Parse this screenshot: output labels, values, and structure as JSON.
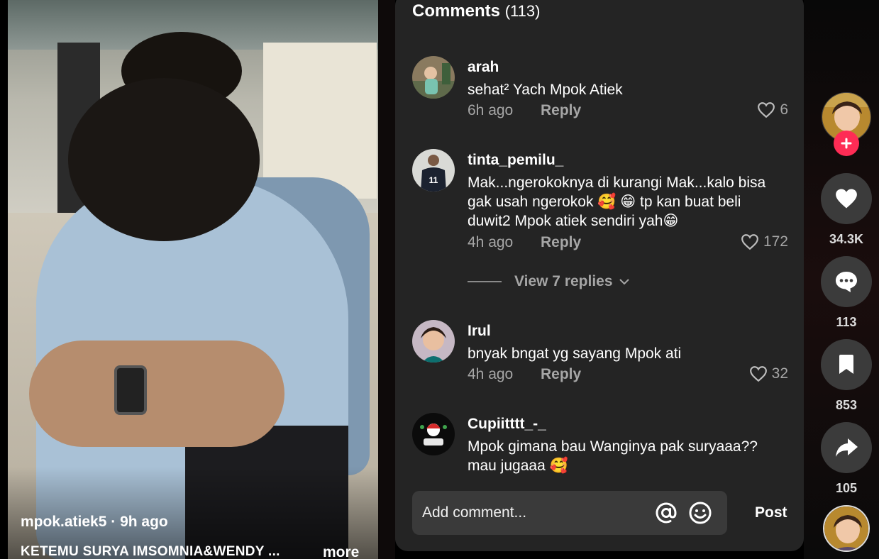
{
  "video": {
    "author": "mpok.atiek5",
    "separator": " · ",
    "posted": "9h ago",
    "caption": "KETEMU SURYA IMSOMNIA&WENDY ...",
    "more_label": "more"
  },
  "comments_header": {
    "title": "Comments",
    "count": "(113)"
  },
  "comments": [
    {
      "username": "arah",
      "text": "sehat² Yach Mpok Atiek",
      "time": "6h ago",
      "reply_label": "Reply",
      "likes": "6"
    },
    {
      "username": "tinta_pemilu_",
      "text": "Mak...ngerokoknya di kurangi Mak...kalo bisa gak usah ngerokok 🥰 😁  tp kan buat beli duwit2 Mpok atiek sendiri yah😁",
      "time": "4h ago",
      "reply_label": "Reply",
      "likes": "172"
    },
    {
      "username": "Irul",
      "text": "bnyak bngat yg sayang Mpok ati",
      "time": "4h ago",
      "reply_label": "Reply",
      "likes": "32"
    },
    {
      "username": "Cupiitttt_-_",
      "text": "Mpok gimana bau Wanginya pak suryaaa?? mau jugaaa 🥰"
    }
  ],
  "view_replies_label": "View 7 replies",
  "comment_input": {
    "placeholder": "Add comment...",
    "post_label": "Post"
  },
  "actions": {
    "likes": "34.3K",
    "comments": "113",
    "bookmarks": "853",
    "shares": "105"
  },
  "colors": {
    "panel_bg": "#242424",
    "accent_red": "#fe2c55",
    "muted_text": "#a6a6a6"
  },
  "icons": [
    "heart-icon",
    "comment-icon",
    "bookmark-icon",
    "share-icon",
    "mention-icon",
    "emoji-icon",
    "chevron-down-icon",
    "plus-icon"
  ]
}
